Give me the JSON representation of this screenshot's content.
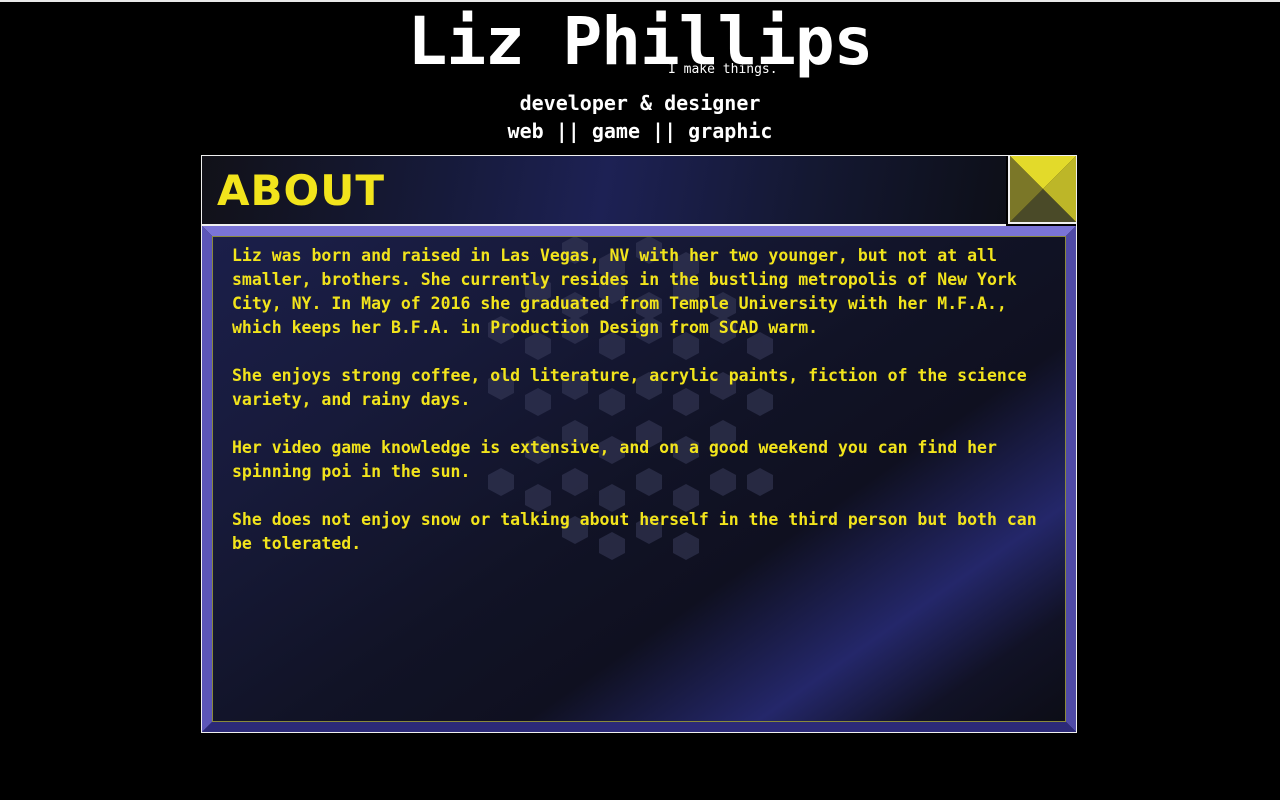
{
  "header": {
    "title": "Liz Phillips",
    "tagline": "I make things.",
    "role": "developer & designer",
    "disciplines": "web || game || graphic"
  },
  "about": {
    "heading": "ABOUT",
    "paragraphs": [
      "Liz was born and raised in Las Vegas, NV with her two younger, but not at all smaller, brothers. She currently resides in the bustling metropolis of New York City, NY. In May of 2016 she graduated from Temple University with her M.F.A., which keeps her B.F.A. in Production Design from SCAD warm.",
      "She enjoys strong coffee, old literature, acrylic paints, fiction of the science variety, and rainy days.",
      "Her video game knowledge is extensive, and on a good weekend you can find her spinning poi in the sun.",
      "She does not enjoy snow or talking about herself in the third person but both can be tolerated."
    ]
  },
  "colors": {
    "background": "#000000",
    "accent_yellow": "#f2e41c",
    "frame_purple": "#6a64c8",
    "panel_navy": "#1d2154"
  },
  "icons": {
    "corner_button": "diagonal-triangle-icon"
  }
}
